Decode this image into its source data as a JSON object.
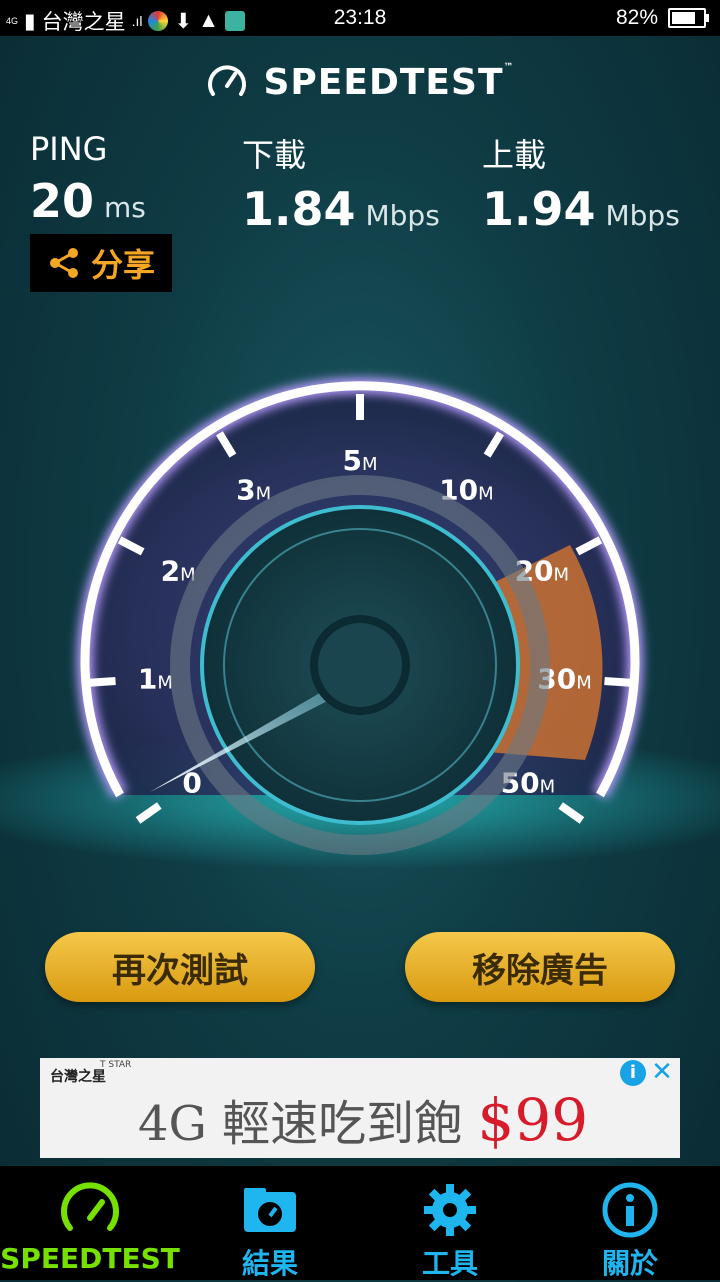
{
  "status_bar": {
    "network": "4G",
    "carrier": "台灣之星",
    "time": "23:18",
    "battery": "82%",
    "battery_level": 0.82
  },
  "header": {
    "title": "SPEEDTEST",
    "trademark": "™"
  },
  "ping": {
    "label": "PING",
    "value": "20",
    "unit": "ms"
  },
  "download": {
    "label": "下載",
    "value": "1.84",
    "unit": "Mbps"
  },
  "upload": {
    "label": "上載",
    "value": "1.94",
    "unit": "Mbps"
  },
  "share_label": "分享",
  "gauge": {
    "ticks": [
      {
        "num": "0",
        "unit": ""
      },
      {
        "num": "1",
        "unit": "M"
      },
      {
        "num": "2",
        "unit": "M"
      },
      {
        "num": "3",
        "unit": "M"
      },
      {
        "num": "5",
        "unit": "M"
      },
      {
        "num": "10",
        "unit": "M"
      },
      {
        "num": "20",
        "unit": "M"
      },
      {
        "num": "30",
        "unit": "M"
      },
      {
        "num": "50",
        "unit": "M"
      }
    ]
  },
  "buttons": {
    "retest": "再次測試",
    "remove_ads": "移除廣告"
  },
  "ad": {
    "brand_small": "T STAR",
    "brand": "台灣之星",
    "headline": "4G 輕速吃到飽",
    "price": "$99",
    "info": "i",
    "close": "✕"
  },
  "tabs": [
    {
      "label": "SPEEDTEST",
      "active": true
    },
    {
      "label": "結果"
    },
    {
      "label": "工具"
    },
    {
      "label": "關於"
    }
  ],
  "colors": {
    "accent_orange": "#f5a623",
    "tab_active": "#76e000",
    "tab_inactive": "#1fb5ef",
    "button_gold": "#e6ac22"
  }
}
